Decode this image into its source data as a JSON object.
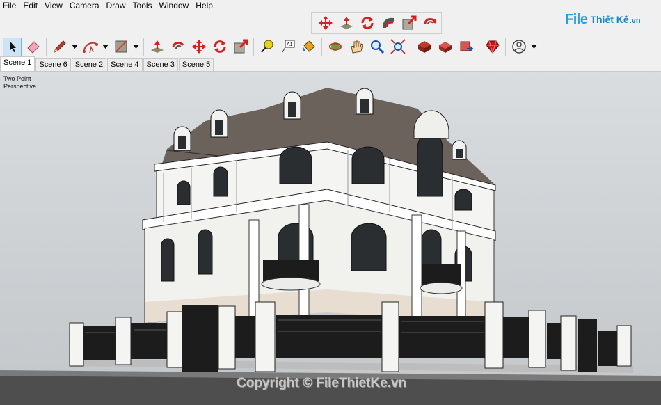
{
  "menu": [
    "File",
    "Edit",
    "View",
    "Camera",
    "Draw",
    "Tools",
    "Window",
    "Help"
  ],
  "logo": {
    "fi": "File",
    "rest": "Thiết Kế",
    "vn": ".vn"
  },
  "toolbar": {
    "float_icons": [
      "move-red-icon",
      "push-pull-icon",
      "rotate-icon",
      "follow-me-icon",
      "scale-icon",
      "offset-icon"
    ],
    "main_icons": [
      "select-arrow-icon",
      "eraser-icon",
      "pencil-icon",
      "arc-icon",
      "paint-bucket-icon",
      "push-pull-icon",
      "offset-icon",
      "move-icon",
      "rotate-icon",
      "scale-icon",
      "tape-measure-icon",
      "text-icon",
      "paint-icon",
      "orbit-icon",
      "pan-icon",
      "zoom-icon",
      "zoom-extents-icon",
      "component-icon",
      "warehouse-icon",
      "extension-icon",
      "ruby-icon",
      "account-icon"
    ]
  },
  "scenes": [
    "Scene 1",
    "Scene 6",
    "Scene 2",
    "Scene 4",
    "Scene 3",
    "Scene 5"
  ],
  "active_scene": "Scene 1",
  "viewport": {
    "camera_line1": "Two Point",
    "camera_line2": "Perspective",
    "watermark": "Copyright © FileThietKe.vn"
  },
  "colors": {
    "accent": "#cde4f7",
    "roof": "#6b625c",
    "wall": "#f4f4f2",
    "ironwork": "#1c1c1c"
  }
}
